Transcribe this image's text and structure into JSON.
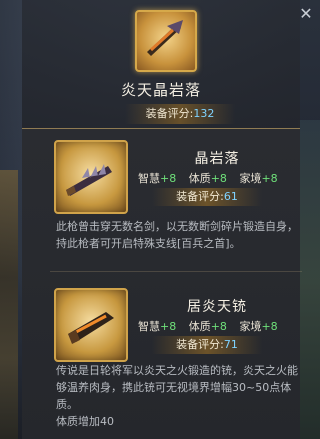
{
  "header": {
    "title": "炎天晶岩落",
    "score_label": "装备评分:",
    "score_value": "132"
  },
  "items": [
    {
      "name": "晶岩落",
      "stats": [
        {
          "label": "智慧",
          "value": "+8"
        },
        {
          "label": "体质",
          "value": "+8"
        },
        {
          "label": "家境",
          "value": "+8"
        }
      ],
      "score_label": "装备评分:",
      "score_value": "61",
      "description": "此枪曾击穿无数名剑，以无数断剑碎片锻造自身，持此枪者可开启特殊支线[百兵之首]。",
      "icon": "spiked-sword-icon"
    },
    {
      "name": "居炎天铳",
      "stats": [
        {
          "label": "智慧",
          "value": "+8"
        },
        {
          "label": "体质",
          "value": "+8"
        },
        {
          "label": "家境",
          "value": "+8"
        }
      ],
      "score_label": "装备评分:",
      "score_value": "71",
      "description": "传说是日轮将军以炎天之火锻造的铳，炎天之火能够温养肉身，携此铳可无视境界增幅30~50点体质。",
      "extra": "体质增加40",
      "icon": "fire-gun-icon"
    }
  ],
  "close_icon": "close-icon"
}
